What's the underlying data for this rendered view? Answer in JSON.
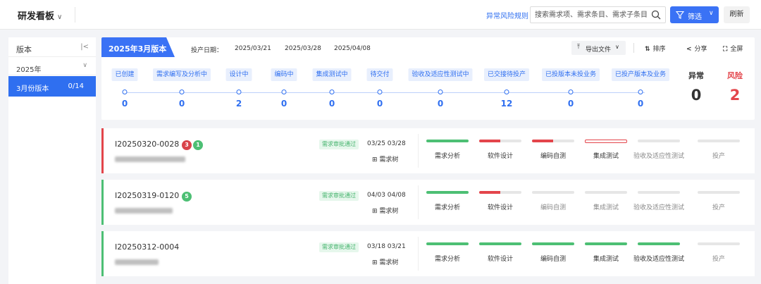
{
  "header": {
    "title": "研发看板",
    "risk_rule_link": "异常风险规则",
    "search_placeholder": "搜索需求项、需求条目、需求子条目",
    "filter_label": "筛选",
    "refresh_label": "刷新"
  },
  "sidebar": {
    "title": "版本",
    "year": "2025年",
    "items": [
      {
        "label": "3月份版本",
        "count": "0/14"
      }
    ]
  },
  "overview": {
    "version_title": "2025年3月版本",
    "production_date_label": "投产日期：",
    "production_dates": [
      "2025/03/21",
      "2025/03/28",
      "2025/04/08"
    ],
    "export_label": "导出文件",
    "sort_label": "排序",
    "share_label": "分享",
    "fullscreen_label": "全屏",
    "stages": [
      {
        "label": "已创建",
        "count": "0"
      },
      {
        "label": "需求编写及分析中",
        "count": "0"
      },
      {
        "label": "设计中",
        "count": "2"
      },
      {
        "label": "编码中",
        "count": "0"
      },
      {
        "label": "集成测试中",
        "count": "0"
      },
      {
        "label": "待交付",
        "count": "0"
      },
      {
        "label": "验收及适应性测试中",
        "count": "0"
      },
      {
        "label": "已交接待投产",
        "count": "12"
      },
      {
        "label": "已投版本未投业务",
        "count": "0"
      },
      {
        "label": "已投产版本及业务",
        "count": "0"
      }
    ],
    "abnormal": {
      "label": "异常",
      "count": "0"
    },
    "risk": {
      "label": "风险",
      "count": "2"
    }
  },
  "phase_labels": [
    "需求分析",
    "软件设计",
    "编码自测",
    "集成测试",
    "验收及适应性测试",
    "投产"
  ],
  "requirements": [
    {
      "id": "I20250320-0028",
      "badges": [
        "3",
        "1"
      ],
      "status": "需求审批通过",
      "dates": "03/25 03/28",
      "tree_label": "需求树",
      "phases": [
        "complete",
        "red-partial",
        "red-partial",
        "red-empty",
        "empty",
        "empty"
      ]
    },
    {
      "id": "I20250319-0120",
      "badges": [
        "5"
      ],
      "status": "需求审批通过",
      "dates": "04/03 04/08",
      "tree_label": "需求树",
      "phases": [
        "complete",
        "red-partial",
        "empty",
        "empty",
        "empty",
        "empty"
      ]
    },
    {
      "id": "I20250312-0004",
      "badges": [],
      "status": "需求审批通过",
      "dates": "03/18 03/21",
      "tree_label": "需求树",
      "phases": [
        "complete",
        "complete",
        "complete",
        "complete",
        "complete",
        "empty"
      ]
    }
  ],
  "colors": {
    "accent": "#2f6ff0",
    "risk": "#e3454b",
    "ok": "#4dbf74",
    "badge_red": "#d9434a",
    "badge_green": "#4dbf74"
  }
}
